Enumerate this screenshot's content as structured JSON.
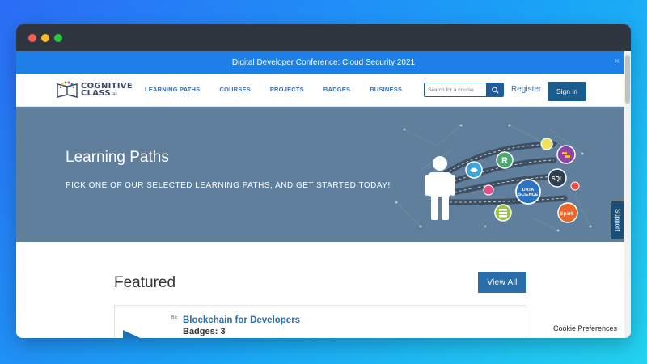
{
  "window": {
    "traffic_lights": {
      "close": "#f25f57",
      "minimize": "#f6be2e",
      "maximize": "#27c840"
    }
  },
  "banner": {
    "link_text": "Digital Developer Conference: Cloud Security 2021",
    "close": "×"
  },
  "logo": {
    "line1": "COGNITIVE",
    "line2": "CLASS",
    "suffix": ".ai"
  },
  "nav": {
    "items": [
      "LEARNING PATHS",
      "COURSES",
      "PROJECTS",
      "BADGES",
      "BUSINESS"
    ]
  },
  "search": {
    "placeholder": "Search for a course",
    "icon": "search-icon"
  },
  "auth": {
    "register": "Register",
    "signin": "Sign in"
  },
  "hero": {
    "title": "Learning Paths",
    "subtitle": "PICK ONE OF OUR SELECTED LEARNING PATHS, AND GET STARTED TODAY!",
    "background": "#5f7f9c",
    "art": {
      "nodes": [
        {
          "label": "R",
          "color": "#49a86b"
        },
        {
          "label": "DATA SCIENCE",
          "color": "#2b73c3"
        },
        {
          "label": "SQL",
          "color": "#2c3e50"
        },
        {
          "label": "Spark",
          "color": "#e8672a"
        }
      ]
    }
  },
  "support": {
    "label": "Support"
  },
  "featured": {
    "title": "Featured",
    "view_all": "View All",
    "card": {
      "thumb_alt": "Blc",
      "title": "Blockchain for Developers",
      "badges": "Badges: 3"
    }
  },
  "cookie": {
    "label": "Cookie Preferences"
  }
}
